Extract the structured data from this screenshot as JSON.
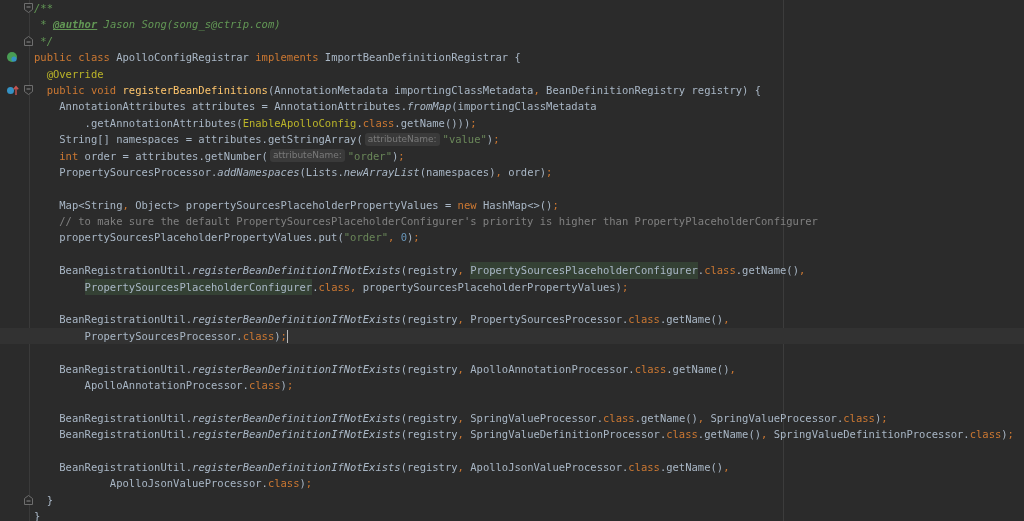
{
  "lines": [
    {
      "kind": "code",
      "current": false,
      "fold": {
        "kind": "open"
      },
      "tokens": [
        {
          "kind": "doc",
          "text": "/**"
        }
      ]
    },
    {
      "kind": "code",
      "current": false,
      "tokens": [
        {
          "kind": "doc",
          "text": " * "
        },
        {
          "kind": "doc-tag",
          "text": "@author"
        },
        {
          "kind": "doc",
          "text": " Jason Song(song_s@ctrip.com)"
        }
      ]
    },
    {
      "kind": "code",
      "current": false,
      "fold": {
        "kind": "close"
      },
      "tokens": [
        {
          "kind": "doc",
          "text": " */"
        }
      ]
    },
    {
      "kind": "code",
      "current": false,
      "gutter": {
        "kind": "implemented"
      },
      "tokens": [
        {
          "kind": "keyword",
          "text": "public class "
        },
        {
          "kind": "plain",
          "text": "ApolloConfigRegistrar "
        },
        {
          "kind": "keyword",
          "text": "implements "
        },
        {
          "kind": "plain",
          "text": "ImportBeanDefinitionRegistrar {"
        }
      ]
    },
    {
      "kind": "code",
      "current": false,
      "tokens": [
        {
          "kind": "annotation",
          "text": "  @Override"
        }
      ]
    },
    {
      "kind": "code",
      "current": false,
      "gutter": {
        "kind": "override"
      },
      "fold": {
        "kind": "open"
      },
      "tokens": [
        {
          "kind": "keyword",
          "text": "  public void "
        },
        {
          "kind": "method",
          "text": "registerBeanDefinitions"
        },
        {
          "kind": "plain",
          "text": "(AnnotationMetadata importingClassMetadata"
        },
        {
          "kind": "punct",
          "text": ", "
        },
        {
          "kind": "plain",
          "text": "BeanDefinitionRegistry registry) {"
        }
      ]
    },
    {
      "kind": "code",
      "current": false,
      "tokens": [
        {
          "kind": "plain",
          "text": "    AnnotationAttributes attributes = AnnotationAttributes."
        },
        {
          "kind": "static",
          "text": "fromMap"
        },
        {
          "kind": "plain",
          "text": "(importingClassMetadata"
        }
      ]
    },
    {
      "kind": "code",
      "current": false,
      "tokens": [
        {
          "kind": "plain",
          "text": "        .getAnnotationAttributes("
        },
        {
          "kind": "annotation",
          "text": "EnableApolloConfig"
        },
        {
          "kind": "plain",
          "text": "."
        },
        {
          "kind": "keyword",
          "text": "class"
        },
        {
          "kind": "plain",
          "text": ".getName()))"
        },
        {
          "kind": "punct",
          "text": ";"
        }
      ]
    },
    {
      "kind": "code",
      "current": false,
      "tokens": [
        {
          "kind": "plain",
          "text": "    String[] namespaces = attributes.getStringArray("
        },
        {
          "kind": "hint",
          "text": "attributeName:"
        },
        {
          "kind": "string",
          "text": "\"value\""
        },
        {
          "kind": "plain",
          "text": ")"
        },
        {
          "kind": "punct",
          "text": ";"
        }
      ]
    },
    {
      "kind": "code",
      "current": false,
      "tokens": [
        {
          "kind": "keyword",
          "text": "    int "
        },
        {
          "kind": "plain",
          "text": "order = attributes.getNumber("
        },
        {
          "kind": "hint",
          "text": "attributeName:"
        },
        {
          "kind": "string",
          "text": "\"order\""
        },
        {
          "kind": "plain",
          "text": ")"
        },
        {
          "kind": "punct",
          "text": ";"
        }
      ]
    },
    {
      "kind": "code",
      "current": false,
      "tokens": [
        {
          "kind": "plain",
          "text": "    PropertySourcesProcessor."
        },
        {
          "kind": "static",
          "text": "addNamespaces"
        },
        {
          "kind": "plain",
          "text": "(Lists."
        },
        {
          "kind": "static",
          "text": "newArrayList"
        },
        {
          "kind": "plain",
          "text": "(namespaces)"
        },
        {
          "kind": "punct",
          "text": ", "
        },
        {
          "kind": "plain",
          "text": "order)"
        },
        {
          "kind": "punct",
          "text": ";"
        }
      ]
    },
    {
      "kind": "blank"
    },
    {
      "kind": "code",
      "current": false,
      "tokens": [
        {
          "kind": "plain",
          "text": "    Map<String"
        },
        {
          "kind": "punct",
          "text": ", "
        },
        {
          "kind": "plain",
          "text": "Object> propertySourcesPlaceholderPropertyValues = "
        },
        {
          "kind": "keyword",
          "text": "new "
        },
        {
          "kind": "plain",
          "text": "HashMap<>()"
        },
        {
          "kind": "punct",
          "text": ";"
        }
      ]
    },
    {
      "kind": "code",
      "current": false,
      "tokens": [
        {
          "kind": "comment",
          "text": "    // to make sure the default PropertySourcesPlaceholderConfigurer's priority is higher than PropertyPlaceholderConfigurer"
        }
      ]
    },
    {
      "kind": "code",
      "current": false,
      "tokens": [
        {
          "kind": "plain",
          "text": "    propertySourcesPlaceholderPropertyValues.put("
        },
        {
          "kind": "string",
          "text": "\"order\""
        },
        {
          "kind": "punct",
          "text": ", "
        },
        {
          "kind": "number",
          "text": "0"
        },
        {
          "kind": "plain",
          "text": ")"
        },
        {
          "kind": "punct",
          "text": ";"
        }
      ]
    },
    {
      "kind": "blank"
    },
    {
      "kind": "code",
      "current": false,
      "tokens": [
        {
          "kind": "plain",
          "text": "    BeanRegistrationUtil."
        },
        {
          "kind": "static",
          "text": "registerBeanDefinitionIfNotExists"
        },
        {
          "kind": "plain",
          "text": "(registry"
        },
        {
          "kind": "punct",
          "text": ", "
        },
        {
          "kind": "highlight",
          "text": "PropertySourcesPlaceholderConfigurer"
        },
        {
          "kind": "plain",
          "text": "."
        },
        {
          "kind": "keyword",
          "text": "class"
        },
        {
          "kind": "plain",
          "text": ".getName()"
        },
        {
          "kind": "punct",
          "text": ","
        }
      ]
    },
    {
      "kind": "code",
      "current": false,
      "tokens": [
        {
          "kind": "highlight",
          "text": "        PropertySourcesPlaceholderConfigurer"
        },
        {
          "kind": "plain",
          "text": "."
        },
        {
          "kind": "keyword",
          "text": "class"
        },
        {
          "kind": "punct",
          "text": ", "
        },
        {
          "kind": "plain",
          "text": "propertySourcesPlaceholderPropertyValues)"
        },
        {
          "kind": "punct",
          "text": ";"
        }
      ]
    },
    {
      "kind": "blank"
    },
    {
      "kind": "code",
      "current": false,
      "tokens": [
        {
          "kind": "plain",
          "text": "    BeanRegistrationUtil."
        },
        {
          "kind": "static",
          "text": "registerBeanDefinitionIfNotExists"
        },
        {
          "kind": "plain",
          "text": "(registry"
        },
        {
          "kind": "punct",
          "text": ", "
        },
        {
          "kind": "plain",
          "text": "PropertySourcesProcessor."
        },
        {
          "kind": "keyword",
          "text": "class"
        },
        {
          "kind": "plain",
          "text": ".getName()"
        },
        {
          "kind": "punct",
          "text": ","
        }
      ]
    },
    {
      "kind": "code",
      "current": true,
      "tokens": [
        {
          "kind": "plain",
          "text": "        PropertySourcesProcessor."
        },
        {
          "kind": "keyword",
          "text": "class"
        },
        {
          "kind": "plain",
          "text": ")"
        },
        {
          "kind": "punct",
          "text": ";"
        }
      ]
    },
    {
      "kind": "blank"
    },
    {
      "kind": "code",
      "current": false,
      "tokens": [
        {
          "kind": "plain",
          "text": "    BeanRegistrationUtil."
        },
        {
          "kind": "static",
          "text": "registerBeanDefinitionIfNotExists"
        },
        {
          "kind": "plain",
          "text": "(registry"
        },
        {
          "kind": "punct",
          "text": ", "
        },
        {
          "kind": "plain",
          "text": "ApolloAnnotationProcessor."
        },
        {
          "kind": "keyword",
          "text": "class"
        },
        {
          "kind": "plain",
          "text": ".getName()"
        },
        {
          "kind": "punct",
          "text": ","
        }
      ]
    },
    {
      "kind": "code",
      "current": false,
      "tokens": [
        {
          "kind": "plain",
          "text": "        ApolloAnnotationProcessor."
        },
        {
          "kind": "keyword",
          "text": "class"
        },
        {
          "kind": "plain",
          "text": ")"
        },
        {
          "kind": "punct",
          "text": ";"
        }
      ]
    },
    {
      "kind": "blank"
    },
    {
      "kind": "code",
      "current": false,
      "tokens": [
        {
          "kind": "plain",
          "text": "    BeanRegistrationUtil."
        },
        {
          "kind": "static",
          "text": "registerBeanDefinitionIfNotExists"
        },
        {
          "kind": "plain",
          "text": "(registry"
        },
        {
          "kind": "punct",
          "text": ", "
        },
        {
          "kind": "plain",
          "text": "SpringValueProcessor."
        },
        {
          "kind": "keyword",
          "text": "class"
        },
        {
          "kind": "plain",
          "text": ".getName()"
        },
        {
          "kind": "punct",
          "text": ", "
        },
        {
          "kind": "plain",
          "text": "SpringValueProcessor."
        },
        {
          "kind": "keyword",
          "text": "class"
        },
        {
          "kind": "plain",
          "text": ")"
        },
        {
          "kind": "punct",
          "text": ";"
        }
      ]
    },
    {
      "kind": "code",
      "current": false,
      "tokens": [
        {
          "kind": "plain",
          "text": "    BeanRegistrationUtil."
        },
        {
          "kind": "static",
          "text": "registerBeanDefinitionIfNotExists"
        },
        {
          "kind": "plain",
          "text": "(registry"
        },
        {
          "kind": "punct",
          "text": ", "
        },
        {
          "kind": "plain",
          "text": "SpringValueDefinitionProcessor."
        },
        {
          "kind": "keyword",
          "text": "class"
        },
        {
          "kind": "plain",
          "text": ".getName()"
        },
        {
          "kind": "punct",
          "text": ", "
        },
        {
          "kind": "plain",
          "text": "SpringValueDefinitionProcessor."
        },
        {
          "kind": "keyword",
          "text": "class"
        },
        {
          "kind": "plain",
          "text": ")"
        },
        {
          "kind": "punct",
          "text": ";"
        }
      ]
    },
    {
      "kind": "blank"
    },
    {
      "kind": "code",
      "current": false,
      "tokens": [
        {
          "kind": "plain",
          "text": "    BeanRegistrationUtil."
        },
        {
          "kind": "static",
          "text": "registerBeanDefinitionIfNotExists"
        },
        {
          "kind": "plain",
          "text": "(registry"
        },
        {
          "kind": "punct",
          "text": ", "
        },
        {
          "kind": "plain",
          "text": "ApolloJsonValueProcessor."
        },
        {
          "kind": "keyword",
          "text": "class"
        },
        {
          "kind": "plain",
          "text": ".getName()"
        },
        {
          "kind": "punct",
          "text": ","
        }
      ]
    },
    {
      "kind": "code",
      "current": false,
      "tokens": [
        {
          "kind": "plain",
          "text": "            ApolloJsonValueProcessor."
        },
        {
          "kind": "keyword",
          "text": "class"
        },
        {
          "kind": "plain",
          "text": ")"
        },
        {
          "kind": "punct",
          "text": ";"
        }
      ]
    },
    {
      "kind": "code",
      "current": false,
      "fold": {
        "kind": "close"
      },
      "tokens": [
        {
          "kind": "plain",
          "text": "  }"
        }
      ]
    },
    {
      "kind": "code",
      "current": false,
      "tokens": [
        {
          "kind": "plain",
          "text": "}"
        }
      ]
    }
  ]
}
